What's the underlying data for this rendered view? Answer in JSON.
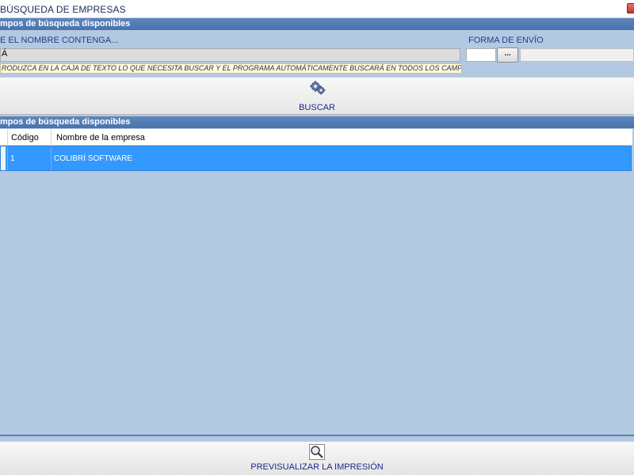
{
  "window": {
    "title": "BÚSQUEDA DE EMPRESAS"
  },
  "filters": {
    "section_title": "mpos de búsqueda disponibles",
    "name_label": "E EL NOMBRE CONTENGA...",
    "name_value": "Á",
    "hint": "RODUZCA EN LA CAJA DE TEXTO LO QUE NECESITA BUSCAR Y EL PROGRAMA AUTOMÁTICAMENTE BUSCARÁ EN TODOS LOS CAMPOS",
    "shipping_label": "FORMA DE ENVÍO",
    "shipping_button": "...",
    "search_button": "BUSCAR",
    "search_icon": "gears-search-icon"
  },
  "results": {
    "section_title": "mpos de búsqueda disponibles",
    "columns": [
      "Código",
      "Nombre de la empresa"
    ],
    "rows": [
      [
        "1",
        "COLIBRÍ SOFTWARE"
      ]
    ],
    "selected_color": "#3399ff"
  },
  "footer": {
    "print_preview_button": "PREVISUALIZAR LA IMPRESIÓN",
    "print_icon": "magnifier-icon"
  }
}
